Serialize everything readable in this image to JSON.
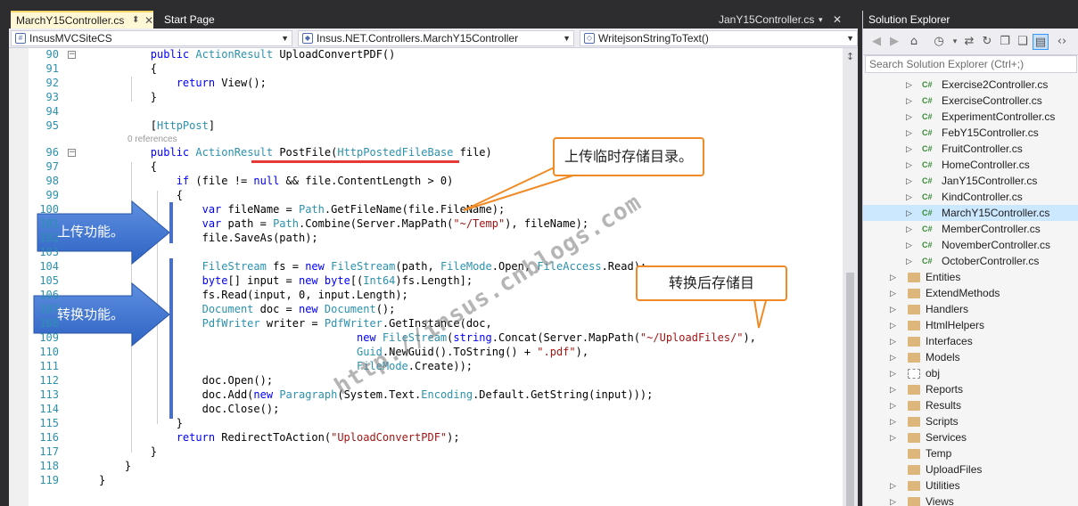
{
  "tabs": {
    "active": "MarchY15Controller.cs",
    "second": "Start Page",
    "right": "JanY15Controller.cs"
  },
  "nav": {
    "project": "InsusMVCSiteCS",
    "class": "Insus.NET.Controllers.MarchY15Controller",
    "member": "WritejsonStringToText()"
  },
  "code_lines": [
    {
      "n": "90",
      "html": "        <span class='kw'>public</span> <span class='ty'>ActionResult</span> UploadConvertPDF()"
    },
    {
      "n": "91",
      "html": "        {"
    },
    {
      "n": "92",
      "html": "            <span class='kw'>return</span> View();"
    },
    {
      "n": "93",
      "html": "        }"
    },
    {
      "n": "94",
      "html": ""
    },
    {
      "n": "95",
      "html": "        [<span class='ty'>HttpPost</span>]"
    },
    {
      "n": "96",
      "html": "        <span class='kw'>public</span> <span class='ty'>ActionResult</span> PostFile(<span class='ty'>HttpPostedFileBase</span> file)"
    },
    {
      "n": "97",
      "html": "        {"
    },
    {
      "n": "98",
      "html": "            <span class='kw'>if</span> (file != <span class='kw'>null</span> &amp;&amp; file.ContentLength &gt; 0)"
    },
    {
      "n": "99",
      "html": "            {"
    },
    {
      "n": "100",
      "html": "                <span class='kw'>var</span> fileName = <span class='ty'>Path</span>.GetFileName(file.FileName);"
    },
    {
      "n": "101",
      "html": "                <span class='kw'>var</span> path = <span class='ty'>Path</span>.Combine(Server.MapPath(<span class='st'>\"~/Temp\"</span>), fileName);"
    },
    {
      "n": "102",
      "html": "                file.SaveAs(path);"
    },
    {
      "n": "103",
      "html": ""
    },
    {
      "n": "104",
      "html": "                <span class='ty'>FileStream</span> fs = <span class='kw'>new</span> <span class='ty'>FileStream</span>(path, <span class='ty'>FileMode</span>.Open, <span class='ty'>FileAccess</span>.Read);"
    },
    {
      "n": "105",
      "html": "                <span class='kw'>byte</span>[] input = <span class='kw'>new</span> <span class='kw'>byte</span>[(<span class='ty'>Int64</span>)fs.Length];"
    },
    {
      "n": "106",
      "html": "                fs.Read(input, 0, input.Length);"
    },
    {
      "n": "107",
      "html": "                <span class='ty'>Document</span> doc = <span class='kw'>new</span> <span class='ty'>Document</span>();"
    },
    {
      "n": "108",
      "html": "                <span class='ty'>PdfWriter</span> writer = <span class='ty'>PdfWriter</span>.GetInstance(doc,"
    },
    {
      "n": "109",
      "html": "                                        <span class='kw'>new</span> <span class='ty'>FileStream</span>(<span class='kw'>string</span>.Concat(Server.MapPath(<span class='st'>\"~/UploadFiles/\"</span>),"
    },
    {
      "n": "110",
      "html": "                                        <span class='ty'>Guid</span>.NewGuid().ToString() + <span class='st'>\".pdf\"</span>),"
    },
    {
      "n": "111",
      "html": "                                        <span class='ty'>FileMode</span>.Create));"
    },
    {
      "n": "112",
      "html": "                doc.Open();"
    },
    {
      "n": "113",
      "html": "                doc.Add(<span class='kw'>new</span> <span class='ty'>Paragraph</span>(System.Text.<span class='ty'>Encoding</span>.Default.GetString(input)));"
    },
    {
      "n": "114",
      "html": "                doc.Close();"
    },
    {
      "n": "115",
      "html": "            }"
    },
    {
      "n": "116",
      "html": "            <span class='kw'>return</span> RedirectToAction(<span class='st'>\"UploadConvertPDF\"</span>);"
    },
    {
      "n": "117",
      "html": "        }"
    },
    {
      "n": "118",
      "html": "    }"
    },
    {
      "n": "119",
      "html": "}"
    }
  ],
  "codelens": "0 references",
  "callouts": {
    "temp_dir": "上传临时存储目录。",
    "convert_dir": "转换后存储目",
    "upload_feature": "上传功能。",
    "convert_feature": "转换功能。"
  },
  "watermark": "http://insus.cnblogs.com",
  "solution_explorer": {
    "title": "Solution Explorer",
    "search_placeholder": "Search Solution Explorer (Ctrl+;)",
    "items": [
      {
        "label": "Exercise2Controller.cs",
        "kind": "cs"
      },
      {
        "label": "ExerciseController.cs",
        "kind": "cs"
      },
      {
        "label": "ExperimentController.cs",
        "kind": "cs"
      },
      {
        "label": "FebY15Controller.cs",
        "kind": "cs"
      },
      {
        "label": "FruitController.cs",
        "kind": "cs"
      },
      {
        "label": "HomeController.cs",
        "kind": "cs"
      },
      {
        "label": "JanY15Controller.cs",
        "kind": "cs"
      },
      {
        "label": "KindController.cs",
        "kind": "cs"
      },
      {
        "label": "MarchY15Controller.cs",
        "kind": "cs",
        "selected": true
      },
      {
        "label": "MemberController.cs",
        "kind": "cs"
      },
      {
        "label": "NovemberController.cs",
        "kind": "cs"
      },
      {
        "label": "OctoberController.cs",
        "kind": "cs"
      },
      {
        "label": "Entities",
        "kind": "folder"
      },
      {
        "label": "ExtendMethods",
        "kind": "folder"
      },
      {
        "label": "Handlers",
        "kind": "folder"
      },
      {
        "label": "HtmlHelpers",
        "kind": "folder"
      },
      {
        "label": "Interfaces",
        "kind": "folder"
      },
      {
        "label": "Models",
        "kind": "folder"
      },
      {
        "label": "obj",
        "kind": "folder-dashed"
      },
      {
        "label": "Reports",
        "kind": "folder"
      },
      {
        "label": "Results",
        "kind": "folder"
      },
      {
        "label": "Scripts",
        "kind": "folder"
      },
      {
        "label": "Services",
        "kind": "folder"
      },
      {
        "label": "Temp",
        "kind": "folder-noexp"
      },
      {
        "label": "UploadFiles",
        "kind": "folder-noexp"
      },
      {
        "label": "Utilities",
        "kind": "folder"
      },
      {
        "label": "Views",
        "kind": "folder"
      }
    ]
  }
}
